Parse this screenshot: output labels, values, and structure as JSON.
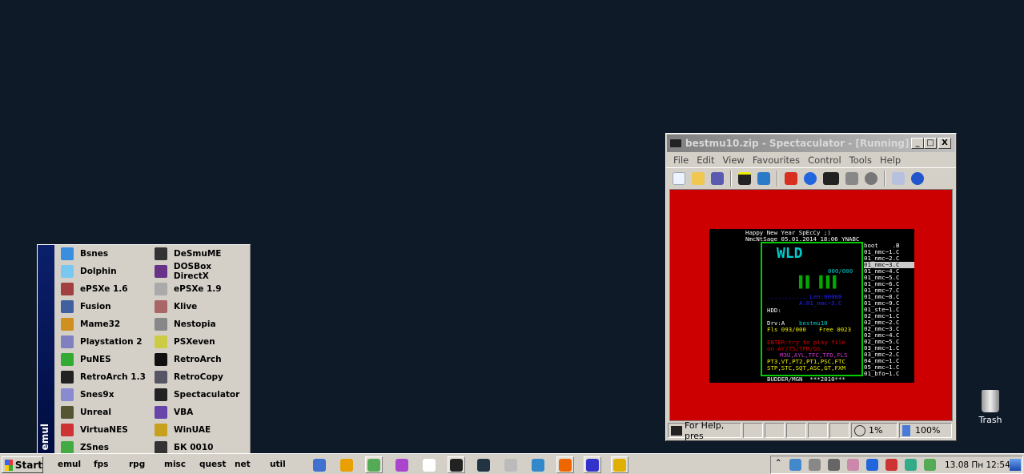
{
  "start_menu": {
    "group": "emul",
    "col1": [
      "Bsnes",
      "Dolphin",
      "ePSXe 1.6",
      "Fusion",
      "Mame32",
      "Playstation 2",
      "PuNES",
      "RetroArch 1.3",
      "Snes9x",
      "Unreal",
      "VirtuaNES",
      "ZSnes"
    ],
    "col2": [
      "DeSmuME",
      "DOSBox DirectX",
      "ePSXe 1.9",
      "Klive",
      "Nestopia",
      "PSXeven",
      "RetroArch",
      "RetroCopy",
      "Spectaculator",
      "VBA",
      "WinUAE",
      "БК 0010"
    ]
  },
  "window": {
    "title": "bestmu10.zip - Spectaculator - [Running]",
    "min": "_",
    "max": "□",
    "close": "X",
    "menu": [
      "File",
      "Edit",
      "View",
      "Favourites",
      "Control",
      "Tools",
      "Help"
    ],
    "status": {
      "help": "For Help, pres",
      "speed": "1%",
      "zoom": "100%"
    }
  },
  "screen": {
    "header1": "Happy New Year SpEcCy ;)",
    "header2": "NmcNtSage 05.01.2014 18:06 YNABC",
    "counter": "000/000",
    "len": "........... Len:00000",
    "file": "A:01_nmc~3.C",
    "hdd": "HDD:",
    "drv": "Drv:A",
    "drv_name": "bestmu10",
    "fls": "Fls 093/000",
    "free": "Free 0023",
    "help1": "ENTER-try to play file",
    "help2": "on AY/TS/TFM/GS...",
    "fmt1": "M3U,AYL,TFC,TFD,FLS",
    "fmt2": "PT3,VT,PT2,PT1,PSC,FTC",
    "fmt3": "STP,STC,SQT,ASC,GT,FXM",
    "footer": "BUDDER/MGN  ***2010***",
    "files": [
      "boot    .B",
      "01_nmc~1.C",
      "01_nmc~2.C",
      "01_nmc~3.C",
      "01_nmc~4.C",
      "01_nmc~5.C",
      "01_nmc~6.C",
      "01_nmc~7.C",
      "01_nmc~8.C",
      "01_nmc~9.C",
      "01_ste~1.C",
      "02_nmc~1.C",
      "02_nmc~2.C",
      "02_nmc~3.C",
      "02_nmc~4.C",
      "02_nmc~5.C",
      "03_nmc~1.C",
      "03_nmc~2.C",
      "04_nmc~1.C",
      "05_nmc~1.C",
      "01_bfo~1.C"
    ],
    "selected_index": 3
  },
  "desktop": {
    "trash": "Trash"
  },
  "taskbar": {
    "start": "Start",
    "quicklaunch": [
      "emul",
      "fps",
      "rpg",
      "misc",
      "quest",
      "net",
      "util"
    ],
    "clock": "13.08 Пн 12:54"
  }
}
